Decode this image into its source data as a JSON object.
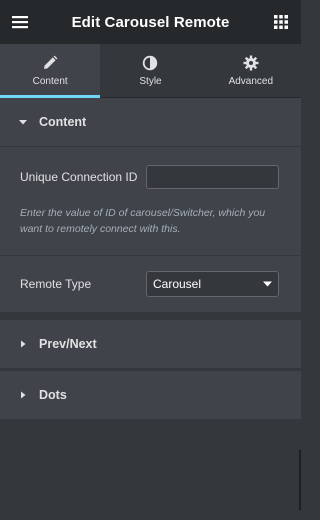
{
  "header": {
    "title": "Edit Carousel Remote",
    "menu_icon": "hamburger-menu-icon",
    "grid_icon": "apps-grid-icon"
  },
  "tabs": [
    {
      "label": "Content",
      "icon": "pencil-icon",
      "active": true
    },
    {
      "label": "Style",
      "icon": "half-circle-icon",
      "active": false
    },
    {
      "label": "Advanced",
      "icon": "gear-icon",
      "active": false
    }
  ],
  "sections": {
    "content": {
      "title": "Content",
      "expanded": true,
      "unique_id_label": "Unique Connection ID",
      "unique_id_value": "",
      "unique_id_help": "Enter the value of ID of carousel/Switcher, which you want to remotely connect with this.",
      "remote_type_label": "Remote Type",
      "remote_type_value": "Carousel"
    },
    "prev_next": {
      "title": "Prev/Next",
      "expanded": false
    },
    "dots": {
      "title": "Dots",
      "expanded": false
    }
  },
  "colors": {
    "header_bg": "#26292c",
    "panel_bg": "#34383c",
    "section_bg": "#404349",
    "accent": "#71d7f7",
    "help_text": "#a4afb7"
  }
}
